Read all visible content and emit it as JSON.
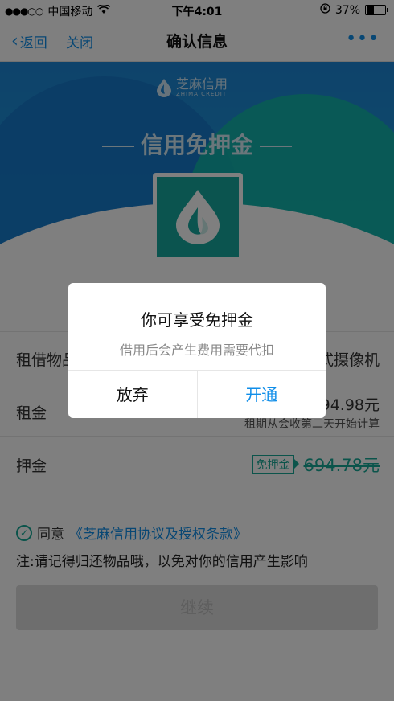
{
  "status_bar": {
    "carrier": "中国移动",
    "time": "下午4:01",
    "battery": "37%"
  },
  "nav": {
    "back": "返回",
    "close": "关闭",
    "title": "确认信息",
    "more": "•••"
  },
  "banner": {
    "brand": "芝麻信用",
    "brand_sub": "ZHIMA CREDIT",
    "title": "信用免押金"
  },
  "product_name_partial": "一 一",
  "rows": {
    "item": {
      "label": "租借物品",
      "value": "式摄像机"
    },
    "rent": {
      "label": "租金",
      "value": "694.98元",
      "note": "租期从会收第二天开始计算"
    },
    "deposit": {
      "label": "押金",
      "tag": "免押金",
      "price": "694.78元"
    }
  },
  "agreement": {
    "prefix": "同意",
    "link": "《芝麻信用协议及授权条款》"
  },
  "note": "注:请记得归还物品哦，以免对你的信用产生影响",
  "continue_label": "继续",
  "dialog": {
    "title": "你可享受免押金",
    "message": "借用后会产生费用需要代扣",
    "cancel": "放弃",
    "confirm": "开通"
  },
  "colors": {
    "accent_blue": "#108ee9",
    "teal": "#16a997",
    "banner_blue": "#1d86d6"
  }
}
